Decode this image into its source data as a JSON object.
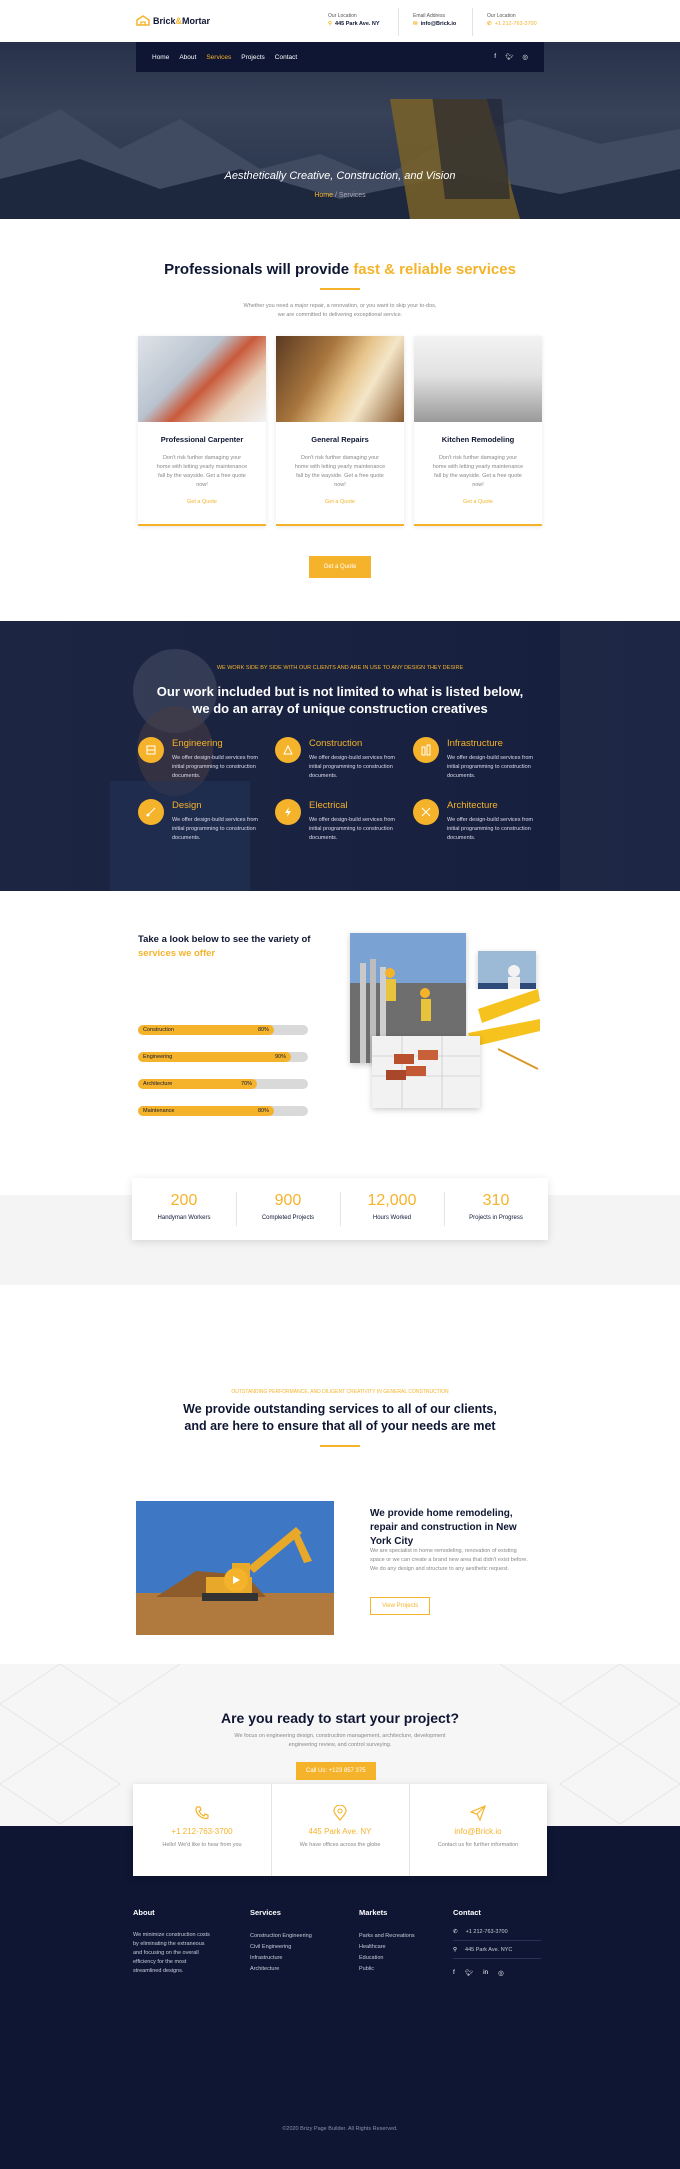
{
  "brand": {
    "name_left": "Brick",
    "name_amp": "&",
    "name_right": "Mortar"
  },
  "topbar": [
    {
      "label": "Our Location",
      "value": "445 Park Ave. NY"
    },
    {
      "label": "Email Address",
      "value": "info@Brick.io"
    },
    {
      "label": "Our Location",
      "value": "+1 212-763-3700"
    }
  ],
  "nav": {
    "items": [
      "Home",
      "About",
      "Services",
      "Projects",
      "Contact"
    ],
    "active": "Services"
  },
  "hero": {
    "title": "Aesthetically Creative, Construction, and Vision",
    "crumb_home": "Home",
    "crumb_sep": " / ",
    "crumb_current": "Services"
  },
  "services": {
    "title_plain": "Professionals will provide ",
    "title_highlight": "fast & reliable services",
    "intro": "Whether you need a major repair, a renovation, or you want to skip your to-dos, we are committed to delivering exceptional service.",
    "cards": [
      {
        "title": "Professional Carpenter",
        "text": "Don't risk further damaging your home with letting yearly maintenance fall by the wayside. Get a free quote now!",
        "link": "Get a Quote"
      },
      {
        "title": "General Repairs",
        "text": "Don't risk further damaging your home with letting yearly maintenance fall by the wayside. Get a free quote now!",
        "link": "Get a Quote"
      },
      {
        "title": "Kitchen Remodeling",
        "text": "Don't risk further damaging your home with letting yearly maintenance fall by the wayside. Get a free quote now!",
        "link": "Get a Quote"
      }
    ],
    "button": "Get a Quote"
  },
  "features": {
    "pretitle": "WE WORK SIDE BY SIDE WITH OUR CLIENTS AND ARE IN USE TO ANY DESIGN THEY DESIRE",
    "title_line1": "Our work included but is not limited to what is listed below,",
    "title_line2": "we do an array of unique construction creatives",
    "items": [
      {
        "title": "Engineering",
        "text": "We offer design-build services from initial programming to construction documents."
      },
      {
        "title": "Construction",
        "text": "We offer design-build services from initial programming to construction documents."
      },
      {
        "title": "Infrastructure",
        "text": "We offer design-build services from initial programming to construction documents."
      },
      {
        "title": "Design",
        "text": "We offer design-build services from initial programming to construction documents."
      },
      {
        "title": "Electrical",
        "text": "We offer design-build services from initial programming to construction documents."
      },
      {
        "title": "Architecture",
        "text": "We offer design-build services from initial programming to construction documents."
      }
    ]
  },
  "progress": {
    "title_plain": "Take a look below to see the variety of",
    "title_highlight": "services we offer",
    "bars": [
      {
        "name": "Construction",
        "value": 80,
        "label": "80%"
      },
      {
        "name": "Engineering",
        "value": 90,
        "label": "90%"
      },
      {
        "name": "Architecture",
        "value": 70,
        "label": "70%"
      },
      {
        "name": "Maintenance",
        "value": 80,
        "label": "80%"
      }
    ]
  },
  "stats": [
    {
      "num": "200",
      "label": "Handyman Workers"
    },
    {
      "num": "900",
      "label": "Completed Projects"
    },
    {
      "num": "12,000",
      "label": "Hours Worked"
    },
    {
      "num": "310",
      "label": "Projects in Progress"
    }
  ],
  "outstanding": {
    "pretitle": "OUTSTANDING PERFORMANCE, AND DILIGENT CREATIVITY IN GENERAL CONSTRUCTION",
    "title_line1": "We provide outstanding services to all of our clients,",
    "title_line2": "and are here to ensure that all of your needs are met",
    "sub_title": "We provide home remodeling, repair and construction in New York City",
    "sub_text": "We are specialist in home remodeling, renovation of existing space or we can create a brand new area that didn't exist before. We do any design and structure to any aesthetic request.",
    "button": "View Projects"
  },
  "cta": {
    "title": "Are you ready to start your project?",
    "text": "We focus on engineering design, construction management, architecture, development engineering review, and control surveying.",
    "button": "Call Us: +123 857 375"
  },
  "contact_boxes": [
    {
      "icon": "phone-icon",
      "value": "+1 212-763-3700",
      "desc": "Hello! We'd like to hear from you"
    },
    {
      "icon": "map-pin-icon",
      "value": "445 Park Ave. NY",
      "desc": "We have offices across the globe"
    },
    {
      "icon": "paper-plane-icon",
      "value": "info@Brick.io",
      "desc": "Contact us for further information"
    }
  ],
  "footer": {
    "about_title": "About",
    "about_text": "We minimize construction costs by eliminating the extraneous and focusing on the overall efficiency for the most streamlined designs.",
    "services_title": "Services",
    "services": [
      "Construction Engineering",
      "Civil Engineering",
      "Infrastructure",
      "Architecture"
    ],
    "markets_title": "Markets",
    "markets": [
      "Parks and Recreations",
      "Healthcare",
      "Education",
      "Public"
    ],
    "contact_title": "Contact",
    "phone": "+1 212-763-3700",
    "address": "445 Park Ave. NYC",
    "copyright": "©2020 Brizy Page Builder. All Rights Reserved."
  },
  "colors": {
    "accent": "#f5b32b",
    "navy": "#0e1633"
  }
}
